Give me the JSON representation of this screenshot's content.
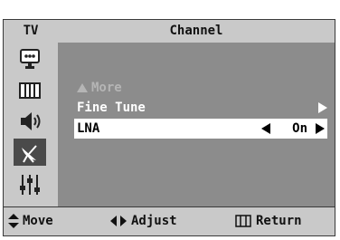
{
  "header": {
    "tv_label": "TV",
    "title": "Channel"
  },
  "sidebar": {
    "items": [
      {
        "icon": "picture-icon"
      },
      {
        "icon": "sound-menu-icon"
      },
      {
        "icon": "speaker-icon"
      },
      {
        "icon": "antenna-icon",
        "active": true
      },
      {
        "icon": "setup-icon"
      }
    ]
  },
  "menu": {
    "more_label": "More",
    "fine_tune_label": "Fine Tune",
    "lna_label": "LNA",
    "lna_value": "On"
  },
  "footer": {
    "move_label": "Move",
    "adjust_label": "Adjust",
    "return_label": "Return"
  },
  "colors": {
    "panel": "#8c8c8c",
    "bar": "#c9c9c9",
    "highlight": "#ffffff",
    "active": "#4a4a4a"
  }
}
